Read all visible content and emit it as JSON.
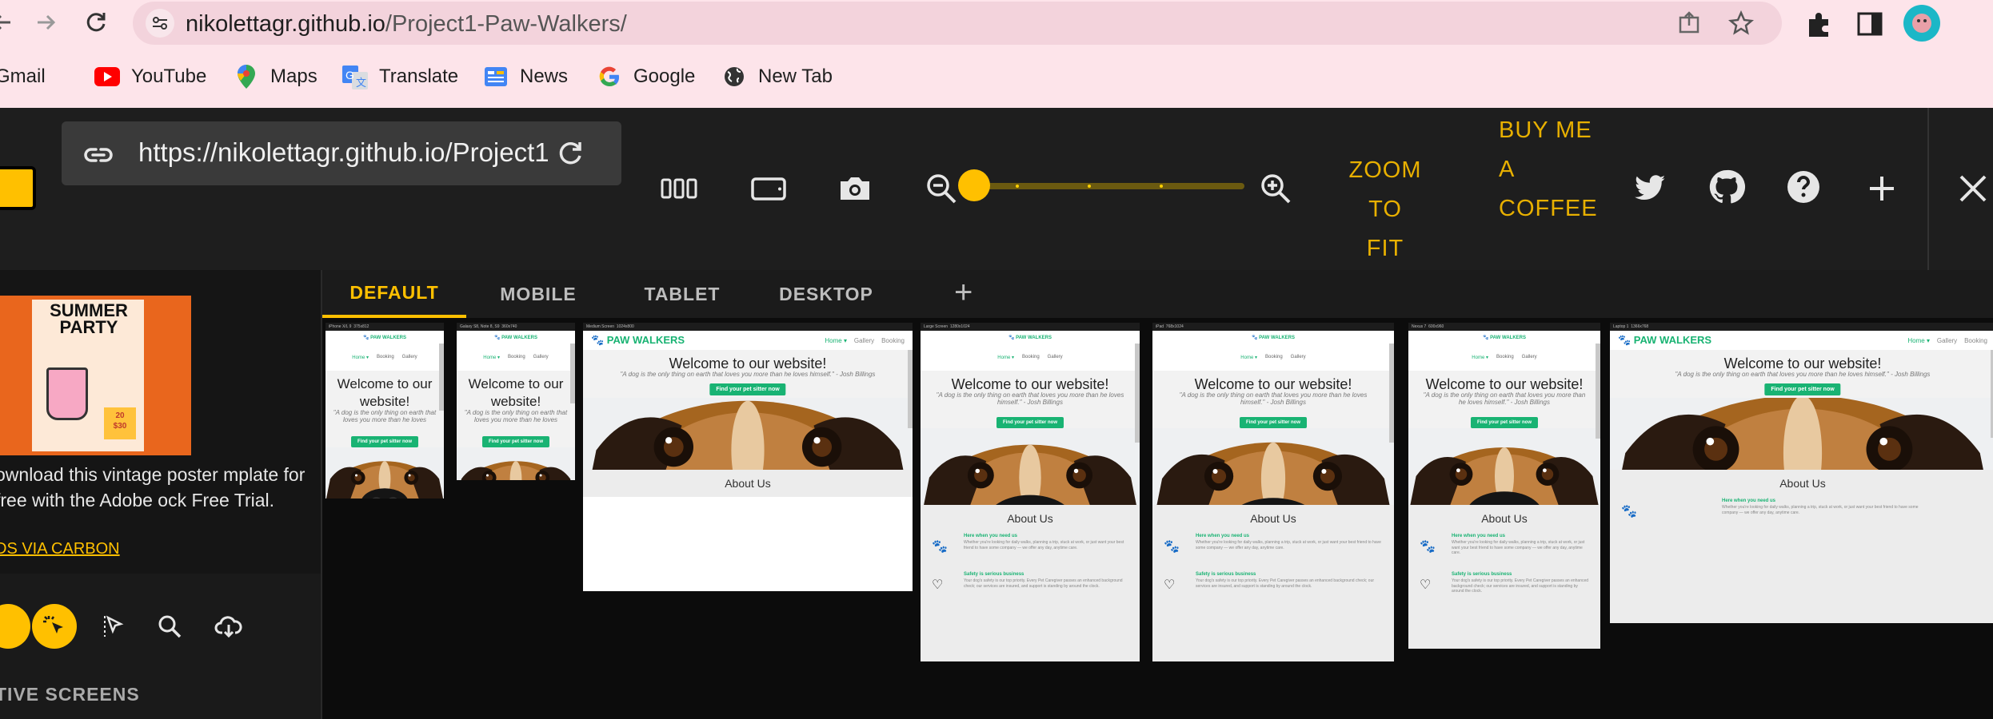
{
  "browser": {
    "url_domain": "nikolettagr.github.io",
    "url_path": "/Project1-Paw-Walkers/",
    "bookmarks": [
      "Gmail",
      "YouTube",
      "Maps",
      "Translate",
      "News",
      "Google",
      "New Tab"
    ]
  },
  "toolbar": {
    "url": "https://nikolettagr.github.io/Project1",
    "zoom_to_fit": [
      "ZOOM TO",
      "FIT"
    ],
    "buy_coffee": [
      "BUY ME",
      "A",
      "COFFEE"
    ],
    "zoom_level": 0
  },
  "sidebar": {
    "ad_title_lines": [
      "SUMMER",
      "PARTY"
    ],
    "ad_text": "ownload this vintage poster mplate for free with the Adobe ock Free Trial.",
    "ad_link": "DS VIA CARBON",
    "section_heading": "TIVE SCREENS",
    "poster_price": "20",
    "poster_price2": "$30"
  },
  "tabs": [
    "DEFAULT",
    "MOBILE",
    "TABLET",
    "DESKTOP"
  ],
  "site": {
    "brand": "PAW WALKERS",
    "nav": [
      "Home",
      "Booking",
      "Gallery"
    ],
    "welcome": "Welcome to our website!",
    "quote": "\"A dog is the only thing on earth that loves you more than he loves himself.\" - Josh Billings",
    "cta": "Find your pet sitter now",
    "about": "About Us",
    "f1_title": "Here when you need us",
    "f1_text": "Whether you're looking for daily walks, planning a trip, stuck at work, or just want your best friend to have some company — we offer any day, anytime care.",
    "f2_title": "Safety is serious business",
    "f2_text": "Your dog's safety is our top priority. Every Pet Caregiver passes an enhanced background check; our services are insured, and support is standing by around the clock."
  },
  "devices": [
    {
      "name": "iPhone X/L 9",
      "res": "375x812"
    },
    {
      "name": "Galaxy S8, Note 8, S9",
      "res": "360x740"
    },
    {
      "name": "Medium Screen",
      "res": "1024x800"
    },
    {
      "name": "Large Screen",
      "res": "1280x1024"
    },
    {
      "name": "iPad",
      "res": "768x1024"
    },
    {
      "name": "Nexus 7",
      "res": "600x960"
    },
    {
      "name": "Laptop 1",
      "res": "1366x768"
    }
  ]
}
